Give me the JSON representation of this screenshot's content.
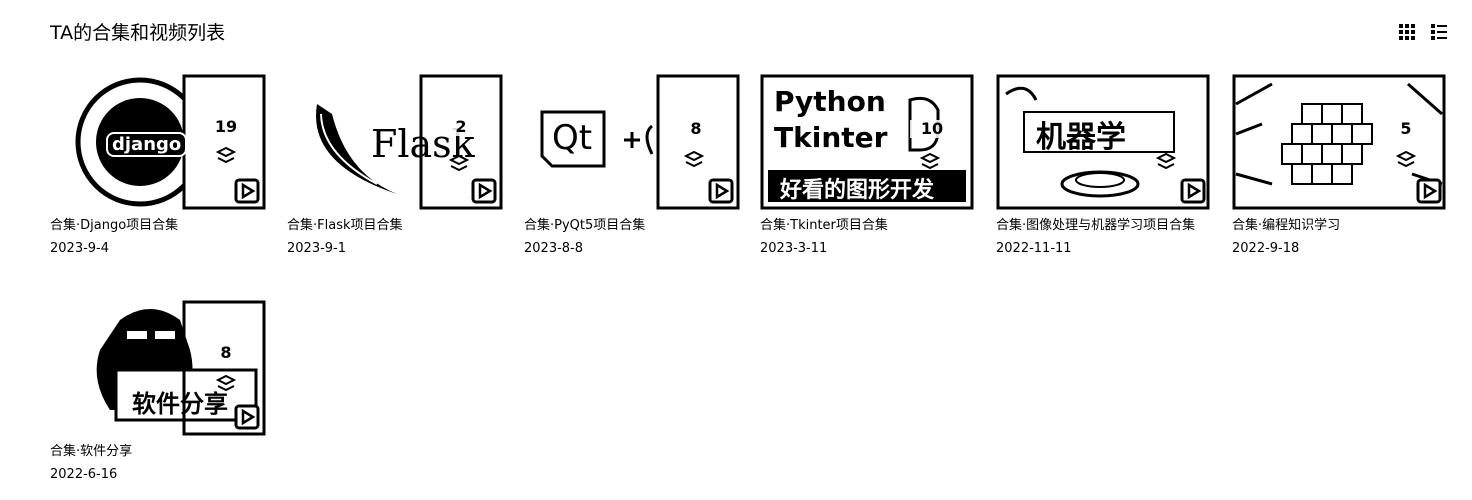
{
  "page": {
    "title": "TA的合集和视频列表",
    "grid_view_icon": "grid-view-icon",
    "list_view_icon": "list-view-icon"
  },
  "collections": [
    {
      "title": "合集·Django项目合集",
      "date": "2023-9-4",
      "count": "19",
      "thumb_text": "django"
    },
    {
      "title": "合集·Flask项目合集",
      "date": "2023-9-1",
      "count": "2",
      "thumb_text": "Flask"
    },
    {
      "title": "合集·PyQt5项目合集",
      "date": "2023-8-8",
      "count": "8",
      "thumb_text": "Qt"
    },
    {
      "title": "合集·Tkinter项目合集",
      "date": "2023-3-11",
      "count": "10",
      "thumb_text": "Python Tkinter",
      "thumb_text2": "好看的图形开发"
    },
    {
      "title": "合集·图像处理与机器学习项目合集",
      "date": "2022-11-11",
      "count": "",
      "thumb_text": "机器学"
    },
    {
      "title": "合集·编程知识学习",
      "date": "2022-9-18",
      "count": "5",
      "thumb_text": ""
    },
    {
      "title": "合集·软件分享",
      "date": "2022-6-16",
      "count": "8",
      "thumb_text": "软件分享"
    }
  ]
}
